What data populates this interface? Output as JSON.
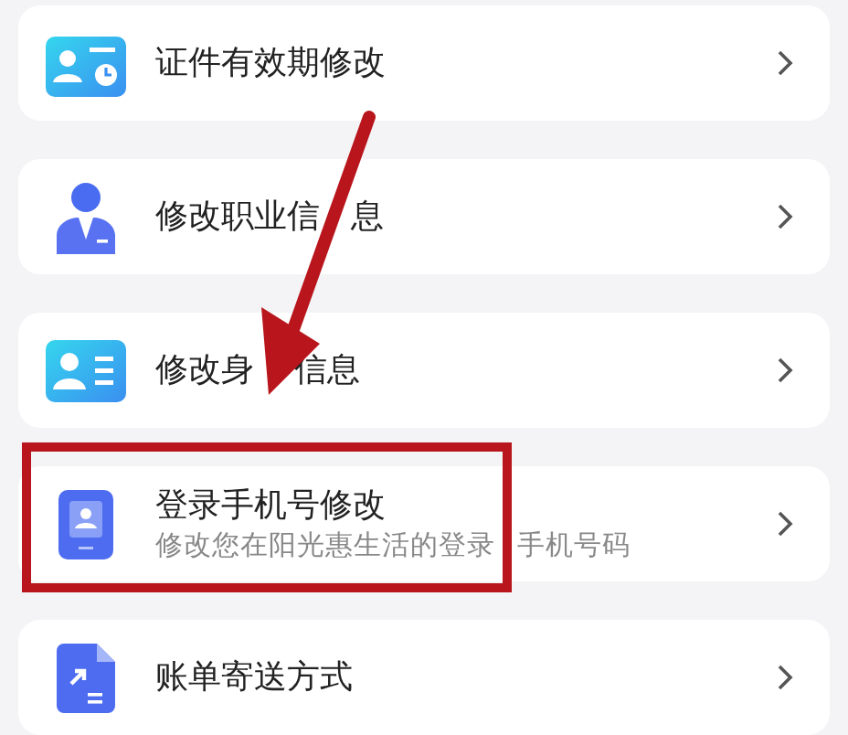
{
  "items": [
    {
      "title": "证件有效期修改",
      "highlighted": false
    },
    {
      "title": "修改职业信",
      "title_after_cover": "息",
      "highlighted": false
    },
    {
      "title": "修改身",
      "title_after_cover": "信息",
      "highlighted": false
    },
    {
      "title": "登录手机号修改",
      "subtitle": "修改您在阳光惠生活的登录",
      "subtitle_after_cover": "手机号码",
      "highlighted": true
    },
    {
      "title": "账单寄送方式",
      "highlighted": false
    }
  ],
  "arrow": true
}
